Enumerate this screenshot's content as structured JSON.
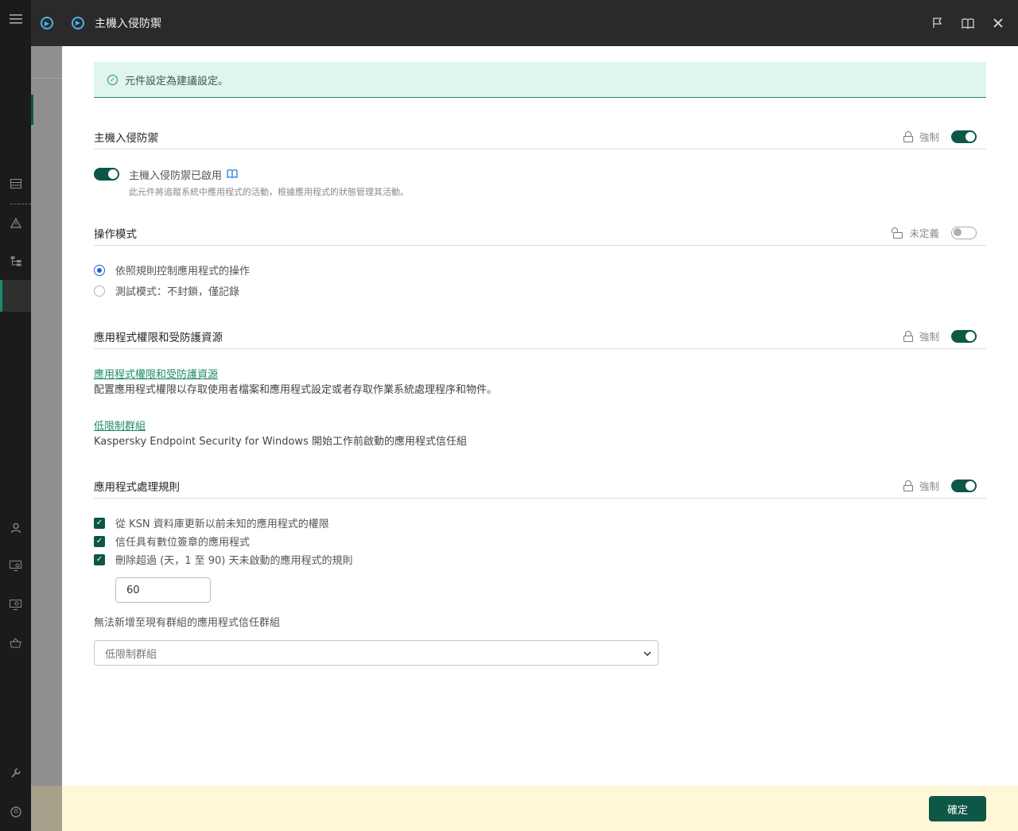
{
  "header": {
    "title": "主機入侵防禦",
    "icons": [
      "menu-icon",
      "play-circle-icon",
      "flag-icon",
      "book-icon",
      "close-icon"
    ]
  },
  "banner": {
    "text": "元件設定為建議設定。"
  },
  "section_hips": {
    "title": "主機入侵防禦",
    "lock_label": "強制",
    "enabled": true,
    "toggle_label": "主機入侵防禦已啟用",
    "toggle_desc": "此元件將追蹤系統中應用程式的活動，根據應用程式的狀態管理其活動。"
  },
  "section_mode": {
    "title": "操作模式",
    "lock_label": "未定義",
    "enabled": false,
    "options": [
      "依照規則控制應用程式的操作",
      "測試模式：不封鎖，僅記錄"
    ],
    "selected": 0
  },
  "section_rights": {
    "title": "應用程式權限和受防護資源",
    "lock_label": "強制",
    "enabled": true,
    "link1": "應用程式權限和受防護資源",
    "link1_desc": "配置應用程式權限以存取使用者檔案和應用程式設定或者存取作業系統處理程序和物件。",
    "link2": "低限制群組",
    "link2_desc": "Kaspersky Endpoint Security for Windows 開始工作前啟動的應用程式信任組"
  },
  "section_rules": {
    "title": "應用程式處理規則",
    "lock_label": "強制",
    "enabled": true,
    "checks": [
      "從 KSN 資料庫更新以前未知的應用程式的權限",
      "信任具有數位簽章的應用程式",
      "刪除超過 (天，1 至 90) 天未啟動的應用程式的規則"
    ],
    "days_value": "60",
    "group_label": "無法新增至現有群組的應用程式信任群組",
    "group_select": "低限制群組"
  },
  "footer": {
    "ok_label": "確定"
  },
  "colors": {
    "accent": "#0d5746",
    "link": "#1f8a6c",
    "banner_bg": "#dff5f0",
    "footer_bg": "#fef8d8"
  }
}
